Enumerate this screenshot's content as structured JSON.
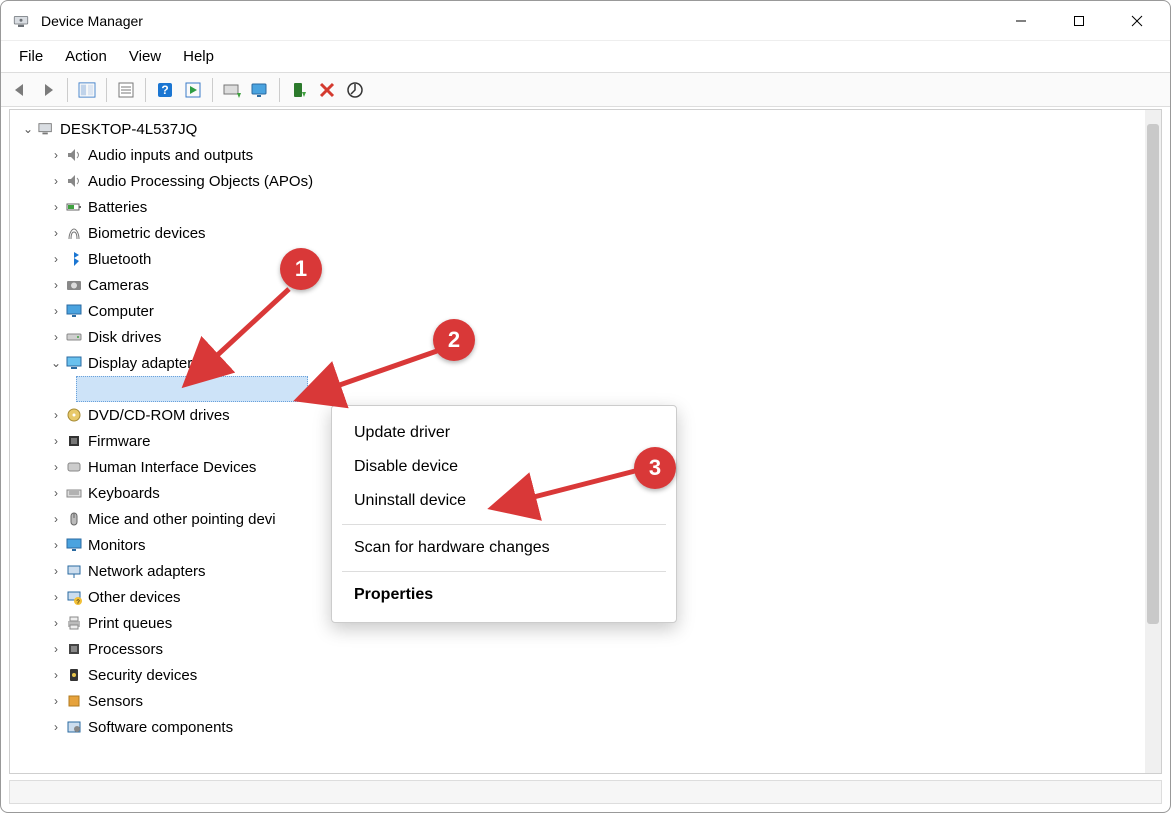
{
  "titlebar": {
    "title": "Device Manager"
  },
  "menubar": {
    "items": [
      "File",
      "Action",
      "View",
      "Help"
    ]
  },
  "tree": {
    "root": "DESKTOP-4L537JQ",
    "nodes": [
      {
        "label": "Audio inputs and outputs",
        "icon": "speaker"
      },
      {
        "label": "Audio Processing Objects (APOs)",
        "icon": "speaker"
      },
      {
        "label": "Batteries",
        "icon": "battery"
      },
      {
        "label": "Biometric devices",
        "icon": "finger"
      },
      {
        "label": "Bluetooth",
        "icon": "bluetooth"
      },
      {
        "label": "Cameras",
        "icon": "camera"
      },
      {
        "label": "Computer",
        "icon": "monitor"
      },
      {
        "label": "Disk drives",
        "icon": "disk"
      },
      {
        "label": "Display adapters",
        "icon": "display",
        "expanded": true
      },
      {
        "label": "DVD/CD-ROM drives",
        "icon": "cd"
      },
      {
        "label": "Firmware",
        "icon": "chip"
      },
      {
        "label": "Human Interface Devices",
        "icon": "hid"
      },
      {
        "label": "Keyboards",
        "icon": "keyboard"
      },
      {
        "label": "Mice and other pointing devi",
        "icon": "mouse"
      },
      {
        "label": "Monitors",
        "icon": "monitor"
      },
      {
        "label": "Network adapters",
        "icon": "network"
      },
      {
        "label": "Other devices",
        "icon": "question"
      },
      {
        "label": "Print queues",
        "icon": "printer"
      },
      {
        "label": "Processors",
        "icon": "cpu"
      },
      {
        "label": "Security devices",
        "icon": "security"
      },
      {
        "label": "Sensors",
        "icon": "sensor"
      },
      {
        "label": "Software components",
        "icon": "software"
      }
    ]
  },
  "context_menu": {
    "items": [
      {
        "label": "Update driver"
      },
      {
        "label": "Disable device"
      },
      {
        "label": "Uninstall device"
      },
      {
        "sep": true
      },
      {
        "label": "Scan for hardware changes"
      },
      {
        "sep": true
      },
      {
        "label": "Properties",
        "bold": true
      }
    ]
  },
  "annotations": {
    "n1": "1",
    "n2": "2",
    "n3": "3"
  }
}
